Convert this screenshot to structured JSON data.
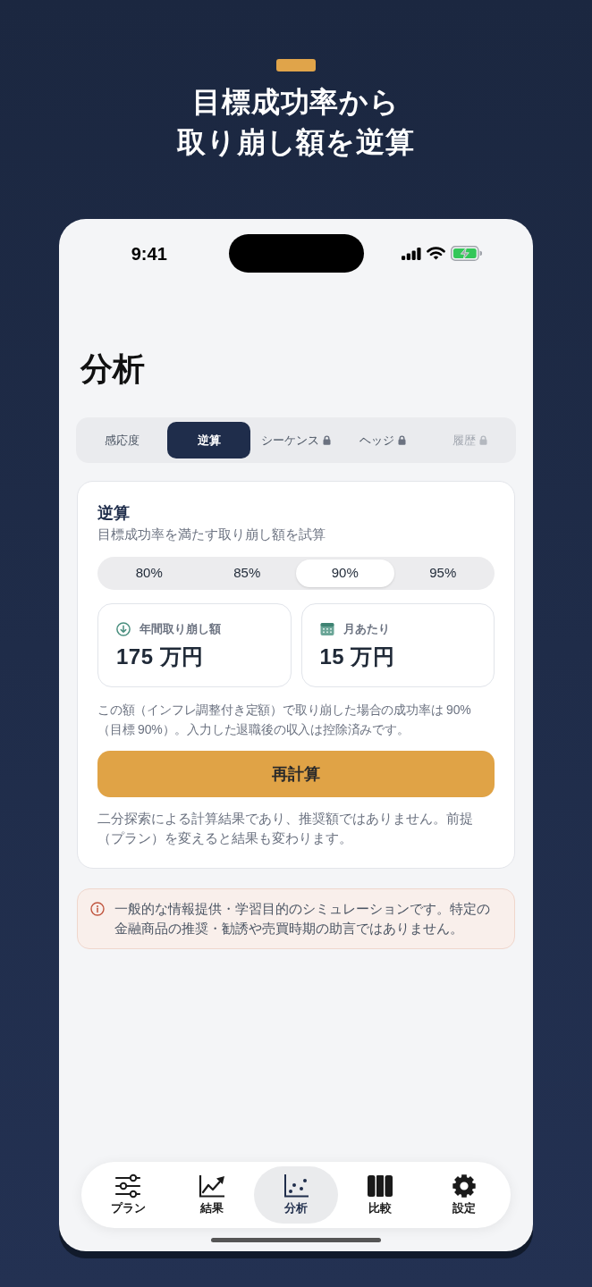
{
  "hero": {
    "title_lines": [
      "目標成功率から",
      "取り崩し額を逆算"
    ]
  },
  "status_bar": {
    "time": "9:41"
  },
  "page_title": "分析",
  "tabs": [
    {
      "label": "感応度",
      "selected": false,
      "locked": false,
      "disabled": false
    },
    {
      "label": "逆算",
      "selected": true,
      "locked": false,
      "disabled": false
    },
    {
      "label": "シーケンス",
      "selected": false,
      "locked": true,
      "disabled": false
    },
    {
      "label": "ヘッジ",
      "selected": false,
      "locked": true,
      "disabled": false
    },
    {
      "label": "履歴",
      "selected": false,
      "locked": true,
      "disabled": true
    }
  ],
  "card": {
    "title": "逆算",
    "subtitle": "目標成功率を満たす取り崩し額を試算",
    "targets": [
      {
        "label": "80%",
        "selected": false
      },
      {
        "label": "85%",
        "selected": false
      },
      {
        "label": "90%",
        "selected": true
      },
      {
        "label": "95%",
        "selected": false
      }
    ],
    "metrics": [
      {
        "kind": "annual",
        "label": "年間取り崩し額",
        "value": "175 万円"
      },
      {
        "kind": "monthly",
        "label": "月あたり",
        "value": "15 万円"
      }
    ],
    "description": "この額（インフレ調整付き定額）で取り崩した場合の成功率は 90%（目標 90%）。入力した退職後の収入は控除済みです。",
    "button": "再計算",
    "note": "二分探索による計算結果であり、推奨額ではありません。前提（プラン）を変えると結果も変わります。"
  },
  "disclaimer": {
    "text": "一般的な情報提供・学習目的のシミュレーションです。特定の金融商品の推奨・勧誘や売買時期の助言ではありません。"
  },
  "bottom_nav": [
    {
      "kind": "sliders",
      "label": "プラン",
      "selected": false
    },
    {
      "kind": "trend",
      "label": "結果",
      "selected": false
    },
    {
      "kind": "scatter",
      "label": "分析",
      "selected": true
    },
    {
      "kind": "columns",
      "label": "比較",
      "selected": false
    },
    {
      "kind": "gear",
      "label": "設定",
      "selected": false
    }
  ]
}
